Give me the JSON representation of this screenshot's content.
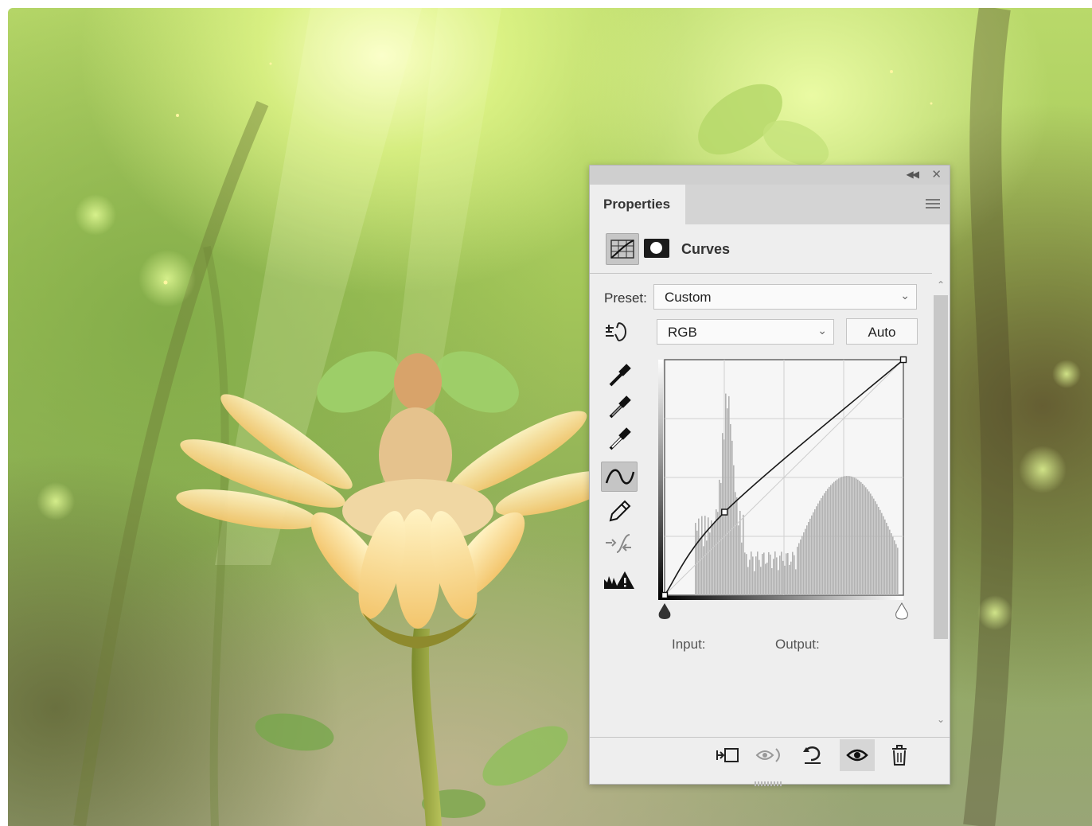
{
  "panel": {
    "tab_label": "Properties",
    "title": "Curves",
    "preset_label": "Preset:",
    "preset_value": "Custom",
    "channel_value": "RGB",
    "auto_label": "Auto",
    "input_label": "Input:",
    "output_label": "Output:"
  },
  "curve": {
    "points": [
      [
        0,
        0
      ],
      [
        64,
        90
      ],
      [
        255,
        255
      ]
    ]
  },
  "icons": {
    "collapse": "double-chevron-left-icon",
    "close": "close-icon",
    "menu": "panel-menu-icon",
    "tools": [
      "on-image-adjust-icon",
      "black-point-eyedropper-icon",
      "gray-point-eyedropper-icon",
      "white-point-eyedropper-icon",
      "curve-points-icon",
      "pencil-draw-icon",
      "smooth-curve-icon",
      "clipping-warning-icon"
    ],
    "footer": [
      "clip-to-layer-icon",
      "view-previous-state-icon",
      "reset-icon",
      "visibility-eye-icon",
      "trash-icon"
    ]
  },
  "colors": {
    "panel_bg": "#eeeeee",
    "tab_strip": "#d4d4d4",
    "histogram": "#b2b2b2"
  }
}
